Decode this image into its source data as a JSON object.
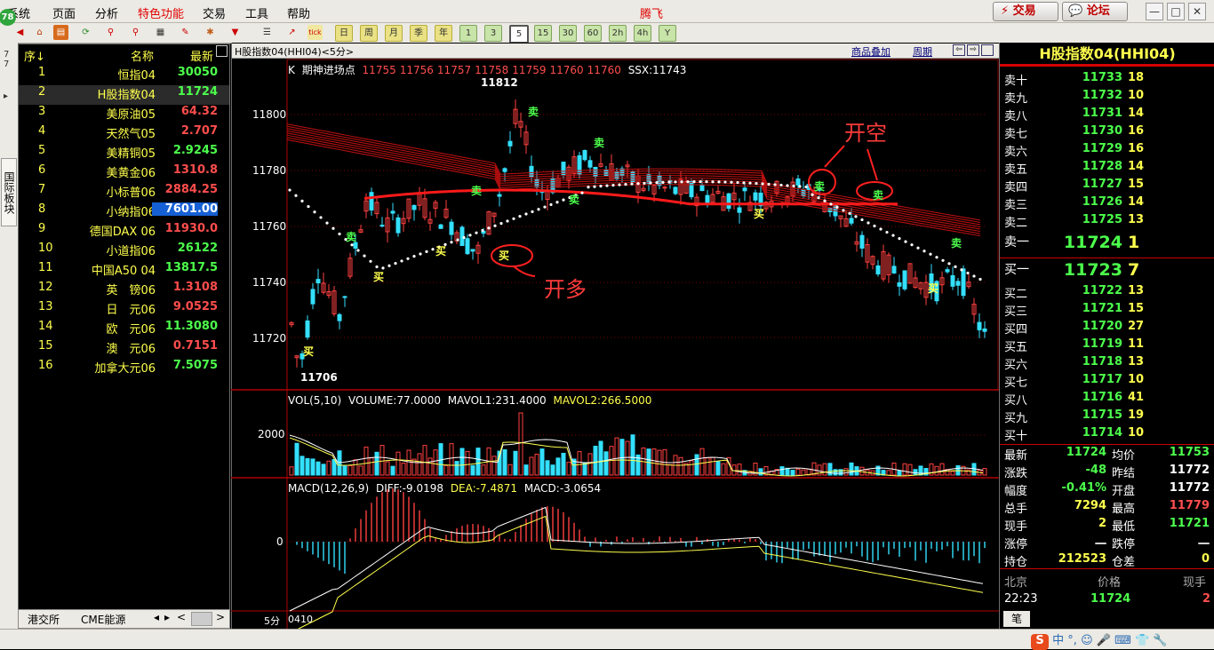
{
  "menu": {
    "items": [
      "系统",
      "页面",
      "分析",
      "特色功能",
      "交易",
      "工具",
      "帮助"
    ],
    "app_title": "腾飞",
    "trade_btn": "交易",
    "forum_btn": "论坛"
  },
  "toolbar": {
    "periods": [
      "日",
      "周",
      "月",
      "季",
      "年"
    ],
    "minutes": [
      "1",
      "3",
      "5",
      "15",
      "30",
      "60",
      "2h",
      "4h",
      "Y"
    ],
    "selected_minute": "5"
  },
  "leftstrip": {
    "logo": "78",
    "tab": "国际板块"
  },
  "watchlist": {
    "headers": {
      "seq": "序",
      "name": "名称",
      "latest": "最新"
    },
    "rows": [
      {
        "seq": "1",
        "name": "恒指04",
        "latest": "30050",
        "color": "#4cff4c"
      },
      {
        "seq": "2",
        "name": "H股指数04",
        "latest": "11724",
        "color": "#4cff4c",
        "selected": true
      },
      {
        "seq": "3",
        "name": "美原油05",
        "latest": "64.32",
        "color": "#ff4d4d"
      },
      {
        "seq": "4",
        "name": "天然气05",
        "latest": "2.707",
        "color": "#ff4d4d"
      },
      {
        "seq": "5",
        "name": "美精铜05",
        "latest": "2.9245",
        "color": "#4cff4c"
      },
      {
        "seq": "6",
        "name": "美黄金06",
        "latest": "1310.8",
        "color": "#ff4d4d"
      },
      {
        "seq": "7",
        "name": "小标普06",
        "latest": "2884.25",
        "color": "#ff4d4d"
      },
      {
        "seq": "8",
        "name": "小纳指06",
        "latest": "7601.00",
        "color": "#ffffff",
        "highlight": true
      },
      {
        "seq": "9",
        "name": "德国DAX 06",
        "latest": "11930.0",
        "color": "#ff4d4d"
      },
      {
        "seq": "10",
        "name": "小道指06",
        "latest": "26122",
        "color": "#4cff4c"
      },
      {
        "seq": "11",
        "name": "中国A50 04",
        "latest": "13817.5",
        "color": "#4cff4c"
      },
      {
        "seq": "12",
        "name": "英　镑06",
        "latest": "1.3108",
        "color": "#ff4d4d"
      },
      {
        "seq": "13",
        "name": "日　元06",
        "latest": "9.0525",
        "color": "#ff4d4d"
      },
      {
        "seq": "14",
        "name": "欧　元06",
        "latest": "11.3080",
        "color": "#4cff4c"
      },
      {
        "seq": "15",
        "name": "澳　元06",
        "latest": "0.7151",
        "color": "#ff4d4d"
      },
      {
        "seq": "16",
        "name": "加拿大元06",
        "latest": "7.5075",
        "color": "#4cff4c"
      }
    ],
    "tabs": [
      "港交所",
      "CME能源"
    ]
  },
  "chart": {
    "title": "H股指数04(HHI04)<5分>",
    "overlay_btn": "商品叠加",
    "period_btn": "周期",
    "indicator_line": {
      "k_label": "K",
      "name": "期神进场点",
      "values": [
        "11755",
        "11756",
        "11757",
        "11758",
        "11759",
        "11760",
        "11760"
      ],
      "ssx": "SSX:11743"
    },
    "price_axis": [
      "11800",
      "11780",
      "11760",
      "11740",
      "11720"
    ],
    "high_label": "11812",
    "low_label": "11706",
    "annot_long": "开多",
    "annot_short": "开空",
    "buy": "买",
    "sell": "卖",
    "vol_line": {
      "title": "VOL(5,10)",
      "volume": "VOLUME:77.0000",
      "mavol1": "MAVOL1:231.4000",
      "mavol2": "MAVOL2:266.5000"
    },
    "vol_axis": "2000",
    "macd_line": {
      "title": "MACD(12,26,9)",
      "diff": "DIFF:-9.0198",
      "dea": "DEA:-7.4871",
      "macd": "MACD:-3.0654"
    },
    "macd_axis": "0",
    "period_label": "5分",
    "date_label": "0410"
  },
  "quote": {
    "title": "H股指数04(HHI04)",
    "asks": [
      {
        "label": "卖十",
        "price": "11733",
        "vol": "18"
      },
      {
        "label": "卖九",
        "price": "11732",
        "vol": "10"
      },
      {
        "label": "卖八",
        "price": "11731",
        "vol": "14"
      },
      {
        "label": "卖七",
        "price": "11730",
        "vol": "16"
      },
      {
        "label": "卖六",
        "price": "11729",
        "vol": "16"
      },
      {
        "label": "卖五",
        "price": "11728",
        "vol": "14"
      },
      {
        "label": "卖四",
        "price": "11727",
        "vol": "15"
      },
      {
        "label": "卖三",
        "price": "11726",
        "vol": "14"
      },
      {
        "label": "卖二",
        "price": "11725",
        "vol": "13"
      },
      {
        "label": "卖一",
        "price": "11724",
        "vol": "1"
      }
    ],
    "bids": [
      {
        "label": "买一",
        "price": "11723",
        "vol": "7"
      },
      {
        "label": "买二",
        "price": "11722",
        "vol": "13"
      },
      {
        "label": "买三",
        "price": "11721",
        "vol": "15"
      },
      {
        "label": "买四",
        "price": "11720",
        "vol": "27"
      },
      {
        "label": "买五",
        "price": "11719",
        "vol": "11"
      },
      {
        "label": "买六",
        "price": "11718",
        "vol": "13"
      },
      {
        "label": "买七",
        "price": "11717",
        "vol": "10"
      },
      {
        "label": "买八",
        "price": "11716",
        "vol": "41"
      },
      {
        "label": "买九",
        "price": "11715",
        "vol": "19"
      },
      {
        "label": "买十",
        "price": "11714",
        "vol": "10"
      }
    ],
    "stats": [
      {
        "l1": "最新",
        "v1": "11724",
        "c1": "#4cff4c",
        "l2": "均价",
        "v2": "11753",
        "c2": "#4cff4c"
      },
      {
        "l1": "涨跌",
        "v1": "-48",
        "c1": "#4cff4c",
        "l2": "昨结",
        "v2": "11772",
        "c2": "#ffffff"
      },
      {
        "l1": "幅度",
        "v1": "-0.41%",
        "c1": "#4cff4c",
        "l2": "开盘",
        "v2": "11772",
        "c2": "#ffffff"
      },
      {
        "l1": "总手",
        "v1": "7294",
        "c1": "#ffff4d",
        "l2": "最高",
        "v2": "11779",
        "c2": "#ff4d4d"
      },
      {
        "l1": "现手",
        "v1": "2",
        "c1": "#ffff4d",
        "l2": "最低",
        "v2": "11721",
        "c2": "#4cff4c"
      },
      {
        "l1": "涨停",
        "v1": "一",
        "c1": "#ffffff",
        "l2": "跌停",
        "v2": "一",
        "c2": "#ffffff"
      },
      {
        "l1": "持仓",
        "v1": "212523",
        "c1": "#ffff4d",
        "l2": "仓差",
        "v2": "0",
        "c2": "#ffff4d"
      }
    ],
    "tick_header": {
      "time": "北京",
      "price": "价格",
      "vol": "现手"
    },
    "tick": {
      "time": "22:23",
      "price": "11724",
      "vol": "2"
    },
    "tab": "笔"
  }
}
